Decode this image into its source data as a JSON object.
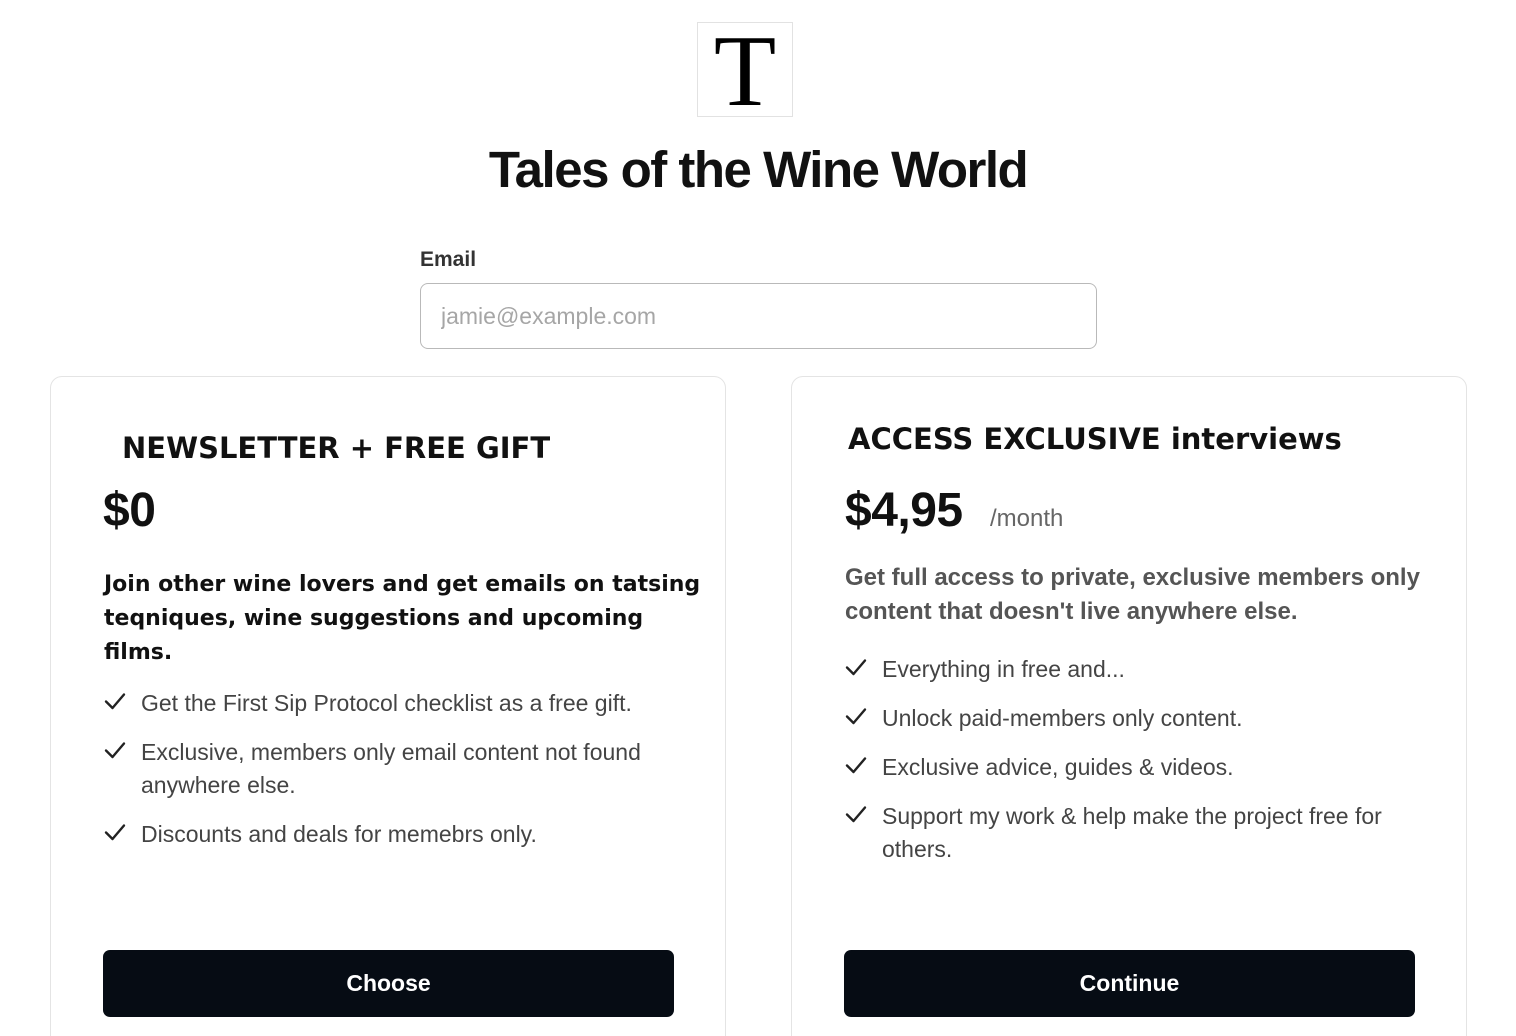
{
  "publication": {
    "logo_letter": "T",
    "title": "Tales of the Wine World"
  },
  "signup": {
    "email_label": "Email",
    "email_placeholder": "jamie@example.com",
    "email_value": ""
  },
  "plans": [
    {
      "name": "NEWSLETTER + FREE GIFT",
      "price": "$0",
      "period": "",
      "description": "Join other wine lovers and get emails on tatsing teqniques, wine suggestions and upcoming films.",
      "features": [
        "Get the  First Sip Protocol checklist  as a free gift.",
        "Exclusive, members only email content not found anywhere else.",
        "Discounts and deals for memebrs only."
      ],
      "button_label": "Choose"
    },
    {
      "name": "ACCESS EXCLUSIVE interviews",
      "price": "$4,95",
      "period": "/month",
      "description": "Get full access to private, exclusive members only content that doesn't live anywhere else.",
      "features": [
        "Everything in free and...",
        "Unlock paid-members only content.",
        "Exclusive advice, guides & videos.",
        "Support my work & help make the project free for others."
      ],
      "button_label": "Continue"
    }
  ],
  "icons": {
    "feature_bullet": "checkmark-icon"
  },
  "colors": {
    "button_bg": "#060c14",
    "button_text": "#ffffff",
    "card_border": "#e4e4e4",
    "input_border": "#b9b9b9"
  }
}
